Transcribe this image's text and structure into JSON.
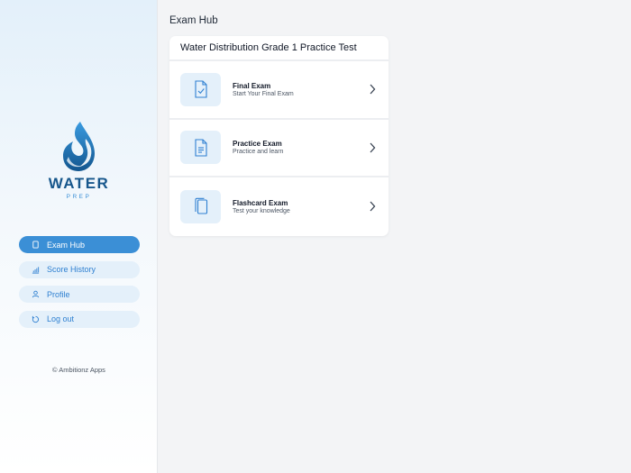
{
  "brand": {
    "name": "WATER",
    "sub": "PREP"
  },
  "sidebar": {
    "items": [
      {
        "label": "Exam Hub",
        "icon": "tablet-icon",
        "active": true
      },
      {
        "label": "Score History",
        "icon": "bar-chart-icon",
        "active": false
      },
      {
        "label": "Profile",
        "icon": "user-icon",
        "active": false
      },
      {
        "label": "Log out",
        "icon": "logout-icon",
        "active": false
      }
    ],
    "copyright": "© Ambitionz Apps"
  },
  "main": {
    "title": "Exam Hub",
    "card": {
      "header": "Water Distribution Grade 1 Practice Test",
      "exams": [
        {
          "title": "Final Exam",
          "subtitle": "Start Your Final Exam",
          "icon": "document-check-icon"
        },
        {
          "title": "Practice Exam",
          "subtitle": "Practice and learn",
          "icon": "document-lines-icon"
        },
        {
          "title": "Flashcard Exam",
          "subtitle": "Test your knowledge",
          "icon": "cards-icon"
        }
      ]
    }
  },
  "colors": {
    "accent": "#3b8fd6",
    "brand": "#17578c",
    "tile": "#e4f0fa"
  }
}
